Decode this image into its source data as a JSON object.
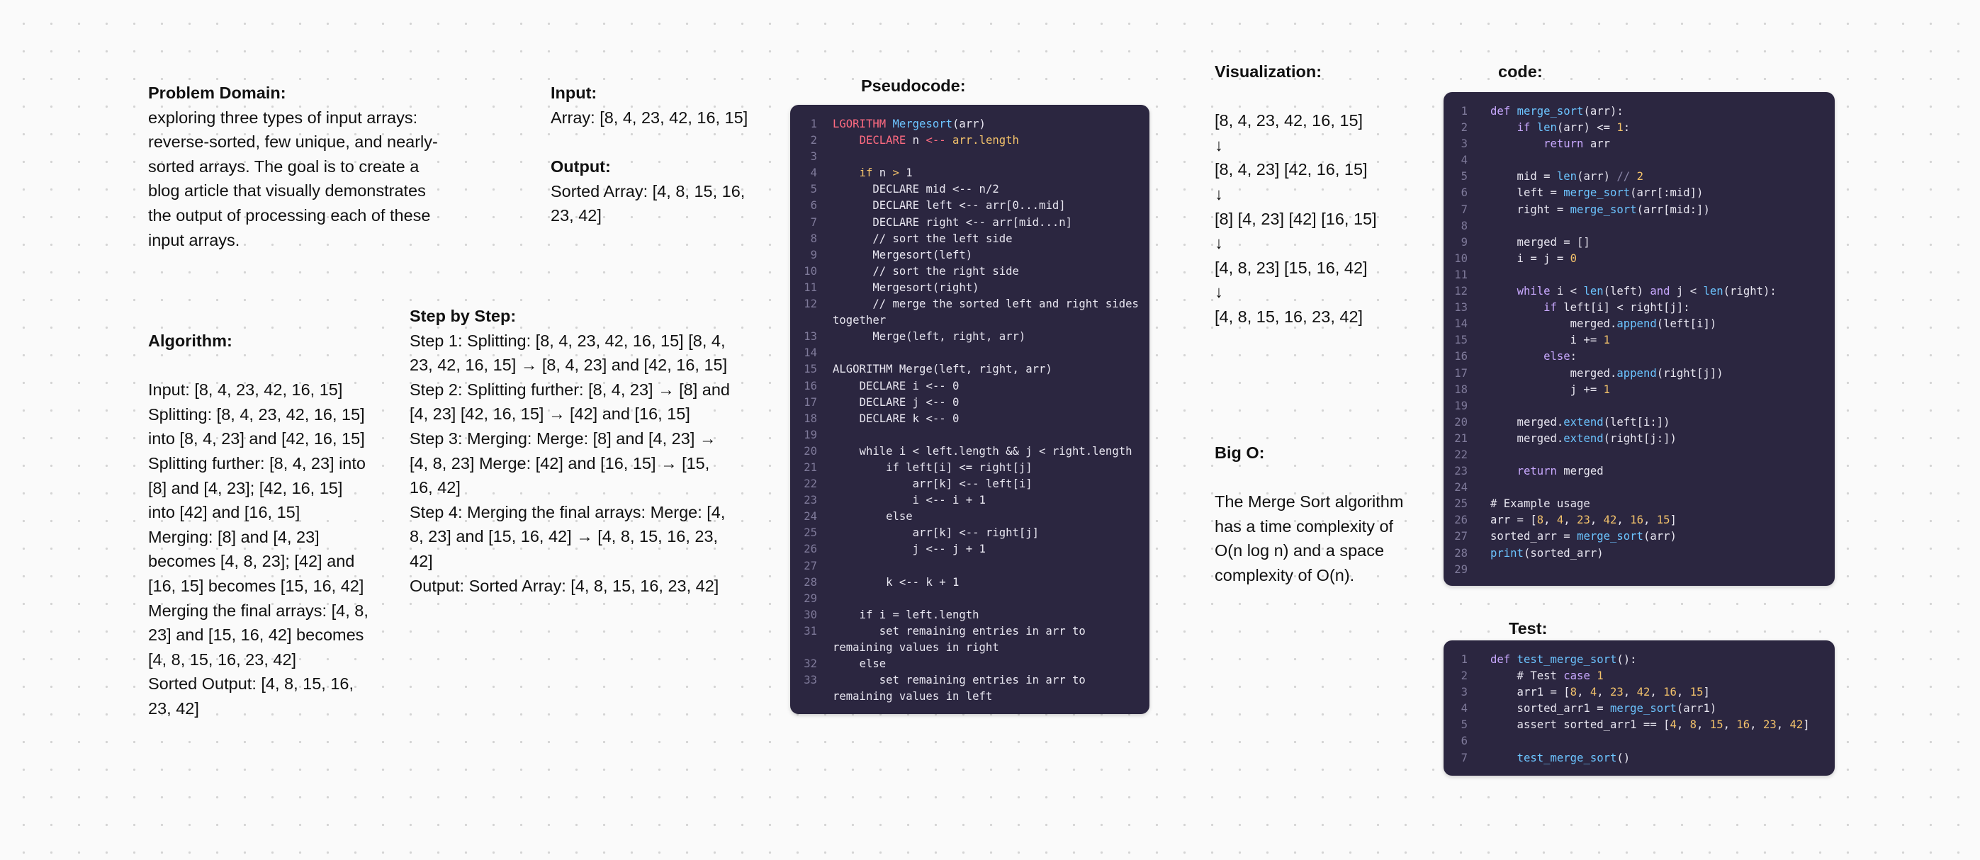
{
  "problem": {
    "heading": "Problem Domain:",
    "body": "exploring three types of input arrays: reverse-sorted, few unique, and nearly-sorted arrays. The goal is to create a blog article that visually demonstrates the output of processing each of these input arrays."
  },
  "io": {
    "input_heading": "Input:",
    "input_value": "Array: [8, 4, 23, 42, 16, 15]",
    "output_heading": "Output:",
    "output_value": "Sorted Array: [4, 8, 15, 16, 23, 42]"
  },
  "algorithm": {
    "heading": "Algorithm:",
    "lines": [
      "Input: [8, 4, 23, 42, 16, 15]",
      "Splitting: [8, 4, 23, 42, 16, 15] into [8, 4, 23] and [42, 16, 15]",
      "Splitting further: [8, 4, 23] into [8] and [4, 23]; [42, 16, 15] into [42] and [16, 15]",
      "Merging: [8] and [4, 23] becomes [4, 8, 23]; [42] and [16, 15] becomes [15, 16, 42]",
      "Merging the final arrays: [4, 8, 23] and [15, 16, 42] becomes [4, 8, 15, 16, 23, 42]",
      "Sorted Output: [4, 8, 15, 16, 23, 42]"
    ]
  },
  "steps": {
    "heading": "Step by Step:",
    "lines": [
      "Step 1: Splitting: [8, 4, 23, 42, 16, 15] [8, 4, 23, 42, 16, 15] → [8, 4, 23] and [42, 16, 15]",
      "Step 2: Splitting further: [8, 4, 23] → [8] and [4, 23] [42, 16, 15] → [42] and [16, 15]",
      "Step 3: Merging: Merge: [8] and [4, 23] → [4, 8, 23] Merge: [42] and [16, 15] → [15, 16, 42]",
      "Step 4: Merging the final arrays: Merge: [4, 8, 23] and [15, 16, 42] → [4, 8, 15, 16, 23, 42]",
      "Output: Sorted Array: [4, 8, 15, 16, 23, 42]"
    ]
  },
  "pseudocode": {
    "heading": "Pseudocode:",
    "lines": [
      {
        "n": "1",
        "t": "LGORITHM Mergesort(arr)"
      },
      {
        "n": "2",
        "t": "    DECLARE n <-- arr.length"
      },
      {
        "n": "3",
        "t": ""
      },
      {
        "n": "4",
        "t": "    if n > 1"
      },
      {
        "n": "5",
        "t": "      DECLARE mid <-- n/2"
      },
      {
        "n": "6",
        "t": "      DECLARE left <-- arr[0...mid]"
      },
      {
        "n": "7",
        "t": "      DECLARE right <-- arr[mid...n]"
      },
      {
        "n": "8",
        "t": "      // sort the left side"
      },
      {
        "n": "9",
        "t": "      Mergesort(left)"
      },
      {
        "n": "10",
        "t": "      // sort the right side"
      },
      {
        "n": "11",
        "t": "      Mergesort(right)"
      },
      {
        "n": "12",
        "t": "      // merge the sorted left and right sides together"
      },
      {
        "n": "13",
        "t": "      Merge(left, right, arr)"
      },
      {
        "n": "14",
        "t": ""
      },
      {
        "n": "15",
        "t": "ALGORITHM Merge(left, right, arr)"
      },
      {
        "n": "16",
        "t": "    DECLARE i <-- 0"
      },
      {
        "n": "17",
        "t": "    DECLARE j <-- 0"
      },
      {
        "n": "18",
        "t": "    DECLARE k <-- 0"
      },
      {
        "n": "19",
        "t": ""
      },
      {
        "n": "20",
        "t": "    while i < left.length && j < right.length"
      },
      {
        "n": "21",
        "t": "        if left[i] <= right[j]"
      },
      {
        "n": "22",
        "t": "            arr[k] <-- left[i]"
      },
      {
        "n": "23",
        "t": "            i <-- i + 1"
      },
      {
        "n": "24",
        "t": "        else"
      },
      {
        "n": "25",
        "t": "            arr[k] <-- right[j]"
      },
      {
        "n": "26",
        "t": "            j <-- j + 1"
      },
      {
        "n": "27",
        "t": ""
      },
      {
        "n": "28",
        "t": "        k <-- k + 1"
      },
      {
        "n": "29",
        "t": ""
      },
      {
        "n": "30",
        "t": "    if i = left.length"
      },
      {
        "n": "31",
        "t": "       set remaining entries in arr to remaining values in right"
      },
      {
        "n": "32",
        "t": "    else"
      },
      {
        "n": "33",
        "t": "       set remaining entries in arr to remaining values in left"
      }
    ]
  },
  "visualization": {
    "heading": "Visualization:",
    "lines": [
      "[8, 4, 23, 42, 16, 15]",
      "↓",
      "[8, 4, 23] [42, 16, 15]",
      "↓",
      "[8] [4, 23] [42] [16, 15]",
      "↓",
      "[4, 8, 23] [15, 16, 42]",
      "↓",
      "[4, 8, 15, 16, 23, 42]"
    ]
  },
  "bigo": {
    "heading": "Big O:",
    "body": "The Merge Sort algorithm has a time complexity of O(n log n) and a space complexity of O(n)."
  },
  "code": {
    "heading": "code:",
    "lines": [
      "def merge_sort(arr):",
      "    if len(arr) <= 1:",
      "        return arr",
      "",
      "    mid = len(arr) // 2",
      "    left = merge_sort(arr[:mid])",
      "    right = merge_sort(arr[mid:])",
      "",
      "    merged = []",
      "    i = j = 0",
      "",
      "    while i < len(left) and j < len(right):",
      "        if left[i] < right[j]:",
      "            merged.append(left[i])",
      "            i += 1",
      "        else:",
      "            merged.append(right[j])",
      "            j += 1",
      "",
      "    merged.extend(left[i:])",
      "    merged.extend(right[j:])",
      "",
      "    return merged",
      "",
      "# Example usage",
      "arr = [8, 4, 23, 42, 16, 15]",
      "sorted_arr = merge_sort(arr)",
      "print(sorted_arr)",
      ""
    ]
  },
  "test": {
    "heading": "Test:",
    "lines": [
      "def test_merge_sort():",
      "    # Test case 1",
      "    arr1 = [8, 4, 23, 42, 16, 15]",
      "    sorted_arr1 = merge_sort(arr1)",
      "    assert sorted_arr1 == [4, 8, 15, 16, 23, 42]",
      "",
      "    test_merge_sort()"
    ]
  }
}
